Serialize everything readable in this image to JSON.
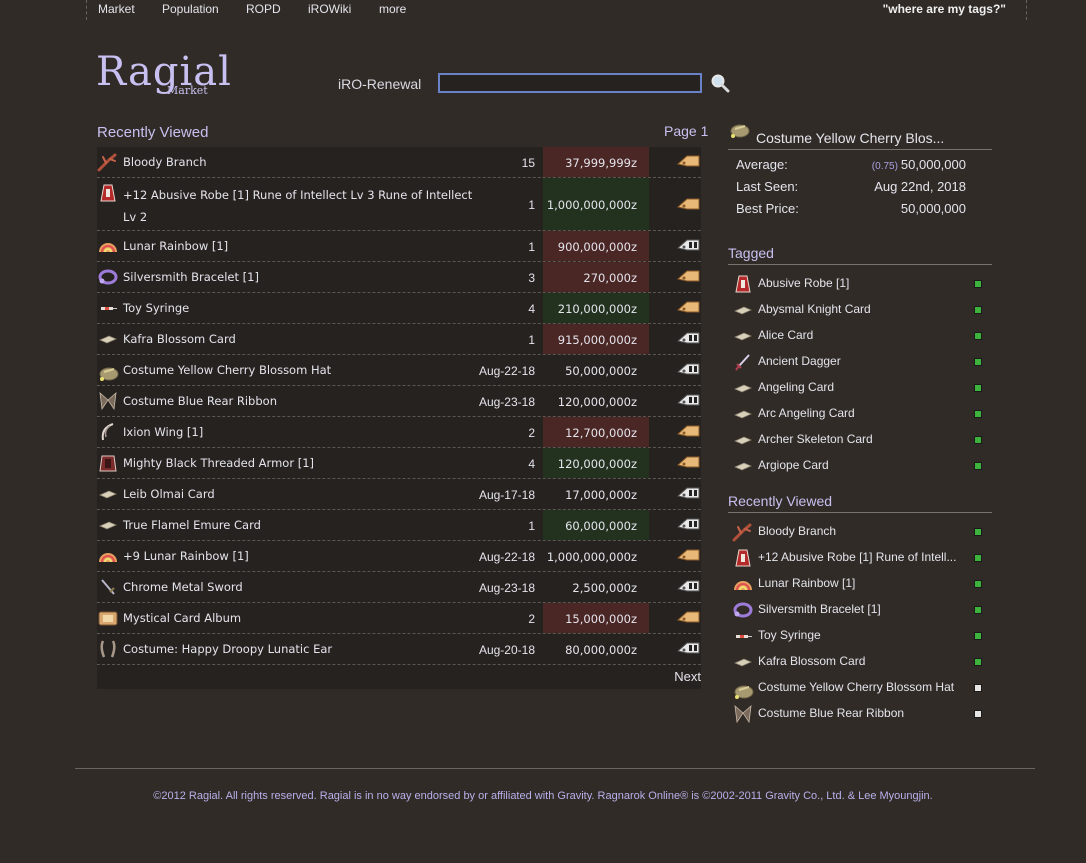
{
  "nav": {
    "links": [
      "Market",
      "Population",
      "ROPD",
      "iROWiki",
      "more"
    ],
    "tags_link": "\"where are my tags?\""
  },
  "logo": {
    "title": "Ragial",
    "subtitle": "Market"
  },
  "search": {
    "server_label": "iRO-Renewal",
    "value": "",
    "placeholder": ""
  },
  "main": {
    "title": "Recently Viewed",
    "page_label": "Page 1",
    "next_label": "Next",
    "rows": [
      {
        "name": "Bloody Branch",
        "qty": "15",
        "price": "37,999,999z",
        "price_status": "red",
        "tag": "orange",
        "icon": "branch-icon"
      },
      {
        "name": "+12 Abusive Robe [1] Rune of Intellect Lv 3 Rune of Intellect Lv 2",
        "qty": "1",
        "price": "1,000,000,000z",
        "price_status": "green",
        "tag": "orange",
        "icon": "robe-icon"
      },
      {
        "name": "Lunar Rainbow [1]",
        "qty": "1",
        "price": "900,000,000z",
        "price_status": "red",
        "tag": "white",
        "icon": "rainbow-icon"
      },
      {
        "name": "Silversmith Bracelet [1]",
        "qty": "3",
        "price": "270,000z",
        "price_status": "red",
        "tag": "orange",
        "icon": "bracelet-icon"
      },
      {
        "name": "Toy Syringe",
        "qty": "4",
        "price": "210,000,000z",
        "price_status": "green",
        "tag": "orange",
        "icon": "syringe-icon"
      },
      {
        "name": "Kafra Blossom Card",
        "qty": "1",
        "price": "915,000,000z",
        "price_status": "red",
        "tag": "white",
        "icon": "card-icon"
      },
      {
        "name": "Costume Yellow Cherry Blossom Hat",
        "qty": "Aug-22-18",
        "price": "50,000,000z",
        "price_status": "none",
        "tag": "white",
        "icon": "hat-icon"
      },
      {
        "name": "Costume Blue Rear Ribbon",
        "qty": "Aug-23-18",
        "price": "120,000,000z",
        "price_status": "none",
        "tag": "white",
        "icon": "ribbon-icon"
      },
      {
        "name": "Ixion Wing [1]",
        "qty": "2",
        "price": "12,700,000z",
        "price_status": "red",
        "tag": "orange",
        "icon": "wing-icon"
      },
      {
        "name": "Mighty Black Threaded Armor [1]",
        "qty": "4",
        "price": "120,000,000z",
        "price_status": "green",
        "tag": "orange",
        "icon": "armor-icon"
      },
      {
        "name": "Leib Olmai Card",
        "qty": "Aug-17-18",
        "price": "17,000,000z",
        "price_status": "none",
        "tag": "white",
        "icon": "card-icon"
      },
      {
        "name": "True Flamel Emure Card",
        "qty": "1",
        "price": "60,000,000z",
        "price_status": "green",
        "tag": "white",
        "icon": "card-icon"
      },
      {
        "name": "+9 Lunar Rainbow [1]",
        "qty": "Aug-22-18",
        "price": "1,000,000,000z",
        "price_status": "none",
        "tag": "orange",
        "icon": "rainbow-icon"
      },
      {
        "name": "Chrome Metal Sword",
        "qty": "Aug-23-18",
        "price": "2,500,000z",
        "price_status": "none",
        "tag": "white",
        "icon": "sword-icon"
      },
      {
        "name": "Mystical Card Album",
        "qty": "2",
        "price": "15,000,000z",
        "price_status": "red",
        "tag": "orange",
        "icon": "album-icon"
      },
      {
        "name": "Costume: Happy Droopy Lunatic Ear",
        "qty": "Aug-20-18",
        "price": "80,000,000z",
        "price_status": "none",
        "tag": "white",
        "icon": "ear-icon"
      }
    ]
  },
  "side": {
    "item_title": "Costume Yellow Cherry Blos...",
    "stats": {
      "average_label": "Average:",
      "average_factor": "(0.75)",
      "average_value": "50,000,000",
      "last_seen_label": "Last Seen:",
      "last_seen_value": "Aug 22nd, 2018",
      "best_price_label": "Best Price:",
      "best_price_value": "50,000,000"
    },
    "tagged_title": "Tagged",
    "tagged": [
      {
        "label": "Abusive Robe [1]",
        "status": "green",
        "icon": "robe-icon"
      },
      {
        "label": "Abysmal Knight Card",
        "status": "green",
        "icon": "card-icon"
      },
      {
        "label": "Alice Card",
        "status": "green",
        "icon": "card-icon"
      },
      {
        "label": "Ancient Dagger",
        "status": "green",
        "icon": "dagger-icon"
      },
      {
        "label": "Angeling Card",
        "status": "green",
        "icon": "card-icon"
      },
      {
        "label": "Arc Angeling Card",
        "status": "green",
        "icon": "card-icon"
      },
      {
        "label": "Archer Skeleton Card",
        "status": "green",
        "icon": "card-icon"
      },
      {
        "label": "Argiope Card",
        "status": "green",
        "icon": "card-icon"
      }
    ],
    "recent_title": "Recently Viewed",
    "recent": [
      {
        "label": "Bloody Branch",
        "status": "green",
        "icon": "branch-icon"
      },
      {
        "label": "+12 Abusive Robe [1] Rune of Intell...",
        "status": "green",
        "icon": "robe-icon"
      },
      {
        "label": "Lunar Rainbow [1]",
        "status": "green",
        "icon": "rainbow-icon"
      },
      {
        "label": "Silversmith Bracelet [1]",
        "status": "green",
        "icon": "bracelet-icon"
      },
      {
        "label": "Toy Syringe",
        "status": "green",
        "icon": "syringe-icon"
      },
      {
        "label": "Kafra Blossom Card",
        "status": "green",
        "icon": "card-icon"
      },
      {
        "label": "Costume Yellow Cherry Blossom Hat",
        "status": "white",
        "icon": "hat-icon"
      },
      {
        "label": "Costume Blue Rear Ribbon",
        "status": "white",
        "icon": "ribbon-icon"
      }
    ]
  },
  "footer": {
    "text": "©2012 Ragial. All rights reserved. Ragial is in no way endorsed by or affiliated with Gravity. Ragnarok Online® is ©2002-2011 Gravity Co., Ltd. & Lee Myoungjin."
  }
}
